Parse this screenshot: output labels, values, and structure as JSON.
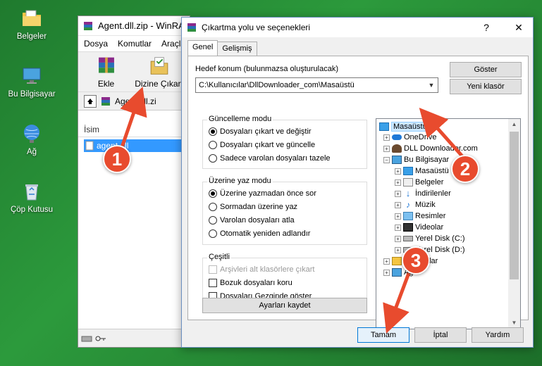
{
  "desktop": {
    "icons": [
      {
        "label": "Belgeler",
        "icon": "folder-documents-icon"
      },
      {
        "label": "Bu Bilgisayar",
        "icon": "this-pc-icon"
      },
      {
        "label": "Ağ",
        "icon": "network-icon"
      },
      {
        "label": "Çöp Kutusu",
        "icon": "recycle-bin-icon"
      }
    ]
  },
  "winrar": {
    "title": "Agent.dll.zip - WinRA",
    "menu": [
      "Dosya",
      "Komutlar",
      "Araçla"
    ],
    "toolbar": {
      "add_label": "Ekle",
      "extract_label": "Dizine Çıkart"
    },
    "address": "Agent.dll.zi",
    "column_name": "İsim",
    "file_name": "agent.dll"
  },
  "dialog": {
    "title": "Çıkartma yolu ve seçenekleri",
    "help": "?",
    "close": "✕",
    "tabs": [
      "Genel",
      "Gelişmiş"
    ],
    "dest_label": "Hedef konum (bulunmazsa oluşturulacak)",
    "dest_value": "C:\\Kullanıcılar\\DllDownloader_com\\Masaüstü",
    "show_button": "Göster",
    "new_folder_button": "Yeni klasör",
    "update_mode": {
      "title": "Güncelleme modu",
      "options": [
        "Dosyaları çıkart ve değiştir",
        "Dosyaları çıkart ve güncelle",
        "Sadece varolan dosyaları tazele"
      ]
    },
    "overwrite_mode": {
      "title": "Üzerine yaz modu",
      "options": [
        "Üzerine yazmadan önce sor",
        "Sormadan üzerine yaz",
        "Varolan dosyaları atla",
        "Otomatik yeniden adlandır"
      ]
    },
    "misc": {
      "title": "Çeşitli",
      "options": [
        "Arşivleri alt klasörlere çıkart",
        "Bozuk dosyaları koru",
        "Dosyaları Gezginde göster"
      ]
    },
    "save_settings_button": "Ayarları kaydet",
    "ok_button": "Tamam",
    "cancel_button": "İptal",
    "help_button": "Yardım",
    "tree": [
      {
        "label": "Masaüstü",
        "icon": "desktop-icon"
      },
      {
        "label": "OneDrive",
        "icon": "onedrive-icon"
      },
      {
        "label": "DLL Downloader.com",
        "icon": "user-icon"
      },
      {
        "label": "Bu Bilgisayar",
        "icon": "this-pc-icon"
      },
      {
        "label": "Masaüstü",
        "icon": "desktop-icon"
      },
      {
        "label": "Belgeler",
        "icon": "documents-icon"
      },
      {
        "label": "İndirilenler",
        "icon": "downloads-icon"
      },
      {
        "label": "Müzik",
        "icon": "music-icon"
      },
      {
        "label": "Resimler",
        "icon": "pictures-icon"
      },
      {
        "label": "Videolar",
        "icon": "videos-icon"
      },
      {
        "label": "Yerel Disk (C:)",
        "icon": "drive-icon"
      },
      {
        "label": "Yerel Disk (D:)",
        "icon": "drive-icon"
      },
      {
        "label": "Kitaplıklar",
        "icon": "libraries-icon"
      },
      {
        "label": "Ağ",
        "icon": "network-icon"
      }
    ]
  },
  "annotations": {
    "step1": "1",
    "step2": "2",
    "step3": "3",
    "color": "#e84b2e"
  }
}
